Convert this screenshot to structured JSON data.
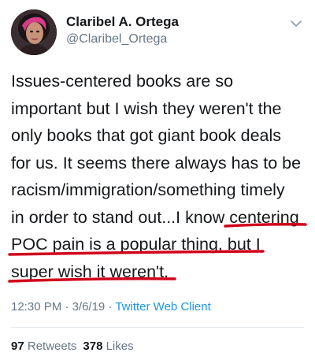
{
  "user": {
    "display_name": "Claribel A. Ortega",
    "handle": "@Claribel_Ortega"
  },
  "icons": {
    "avatar": "profile-avatar",
    "menu": "chevron-down-icon"
  },
  "tweet": {
    "lines": [
      "Issues-centered books are so",
      "important but I wish they weren't the",
      "only books that got giant book deals",
      "for us. It seems there always has to be",
      "racism/immigration/something timely"
    ],
    "line6_plain": "in order to stand out...I know ",
    "line6_marked": "centering",
    "line7_marked": "POC pain is a popular thing, but I",
    "line8_marked": "super wish it weren't."
  },
  "meta": {
    "time": "12:30 PM",
    "separator": " · ",
    "date": "3/6/19",
    "client": "Twitter Web Client"
  },
  "stats": {
    "retweets_count": "97",
    "retweets_label": "Retweets",
    "likes_count": "378",
    "likes_label": "Likes"
  },
  "colors": {
    "underline": "#d0021b",
    "link": "#1b95e0",
    "muted": "#657786",
    "text": "#14171a"
  }
}
